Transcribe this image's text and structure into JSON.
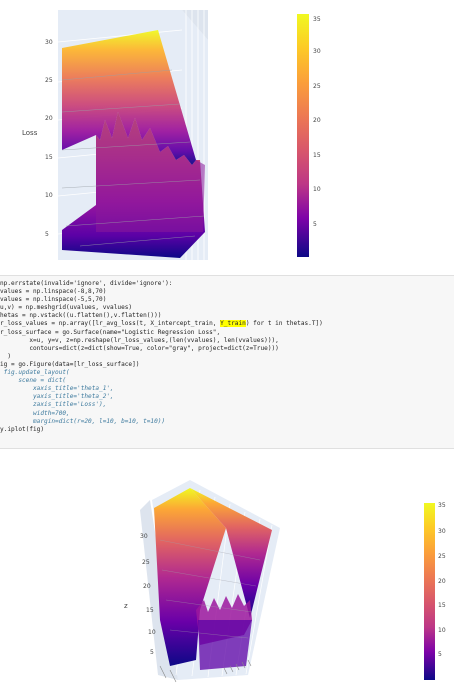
{
  "plot_top": {
    "axis_title": "Loss",
    "z_ticks": [
      "30",
      "25",
      "20",
      "15",
      "10",
      "5"
    ],
    "colorbar_ticks": [
      "35",
      "30",
      "25",
      "20",
      "15",
      "10",
      "5"
    ]
  },
  "code": {
    "lines": [
      "np.errstate(invalid='ignore', divide='ignore'):",
      "values = np.linspace(-8,8,70)",
      "values = np.linspace(-5,5,70)",
      "u,v) = np.meshgrid(uvalues, vvalues)",
      "hetas = np.vstack((u.flatten(),v.flatten()))",
      "r_loss_values = np.array([lr_avg_loss(t, X_intercept_train, ",
      "Y_train",
      ") for t in thetas.T])",
      "r_loss_surface = go.Surface(name=\"Logistic Regression Loss\",",
      "        x=u, y=v, z=np.reshape(lr_loss_values,(len(vvalues), len(vvalues))),",
      "        contours=dict(z=dict(show=True, color=\"gray\", project=dict(z=True)))",
      "  )",
      "ig = go.Figure(data=[lr_loss_surface])",
      " fig.update_layout(",
      "     scene = dict(",
      "         xaxis_title='theta_1',",
      "         yaxis_title='theta_2',",
      "         zaxis_title='Loss'),",
      "         width=700,",
      "         margin=dict(r=20, l=10, b=10, t=10))",
      "y.iplot(fig)"
    ]
  },
  "plot_bottom": {
    "z_axis_letter": "z",
    "z_ticks": [
      "30",
      "25",
      "20",
      "15",
      "10",
      "5"
    ],
    "colorbar_ticks": [
      "35",
      "30",
      "25",
      "20",
      "15",
      "10",
      "5"
    ]
  },
  "colors": {
    "plasma_top": "#f0f921",
    "plasma_mid": "#cc4778",
    "plasma_low": "#7e03a8",
    "plasma_bottom": "#0d0887"
  }
}
